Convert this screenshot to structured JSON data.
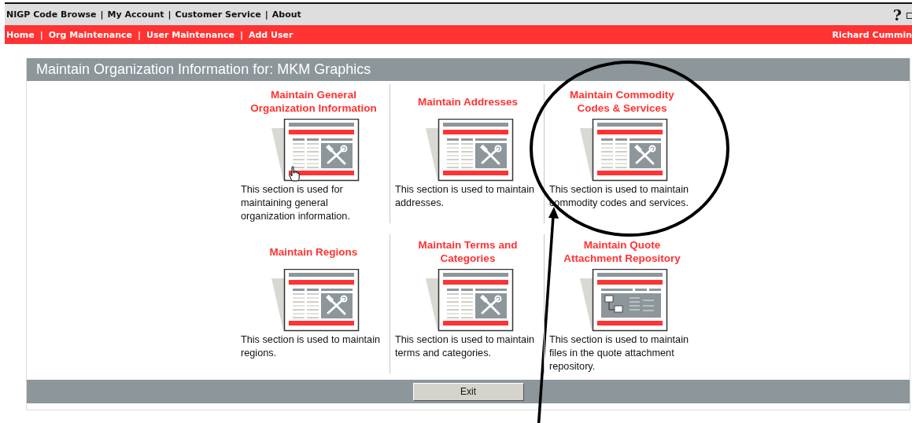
{
  "top_links": [
    {
      "text": "NIGP Code Browse",
      "kind": "link"
    },
    {
      "text": "|",
      "kind": "separator"
    },
    {
      "text": "My Account",
      "kind": "link"
    },
    {
      "text": "|",
      "kind": "separator"
    },
    {
      "text": "Customer Service",
      "kind": "link"
    },
    {
      "text": "|",
      "kind": "separator"
    },
    {
      "text": "About",
      "kind": "link"
    }
  ],
  "help": "?",
  "nav_links": [
    {
      "text": "Home",
      "kind": "link"
    },
    {
      "text": "|",
      "kind": "separator"
    },
    {
      "text": "Org Maintenance",
      "kind": "link"
    },
    {
      "text": "|",
      "kind": "separator"
    },
    {
      "text": "User Maintenance",
      "kind": "link"
    },
    {
      "text": "|",
      "kind": "separator"
    },
    {
      "text": "Add User",
      "kind": "link"
    }
  ],
  "user_name": "Richard Cummin",
  "panel": {
    "title": "Maintain Organization Information for: MKM Graphics",
    "sections": [
      {
        "title": "Maintain General Organization Information",
        "description": "This section is used for maintaining general organization information.",
        "kind": "tools",
        "hovered": true,
        "circled": false
      },
      {
        "title": "Maintain Addresses",
        "description": "This section is used to maintain addresses.",
        "kind": "tools",
        "hovered": false,
        "circled": false
      },
      {
        "title": "Maintain Commodity Codes & Services",
        "description": "This section is used to maintain commodity codes and services.",
        "kind": "tools",
        "hovered": false,
        "circled": true
      },
      {
        "title": "Maintain Regions",
        "description": "This section is used to maintain regions.",
        "kind": "tools",
        "hovered": false,
        "circled": false
      },
      {
        "title": "Maintain Terms and Categories",
        "description": "This section is used to maintain terms and categories.",
        "kind": "tools",
        "hovered": false,
        "circled": false
      },
      {
        "title": "Maintain Quote Attachment Repository",
        "description": "This section is used to maintain files in the quote attachment repository.",
        "kind": "files",
        "hovered": false,
        "circled": false
      }
    ],
    "exit_button": "Exit"
  }
}
